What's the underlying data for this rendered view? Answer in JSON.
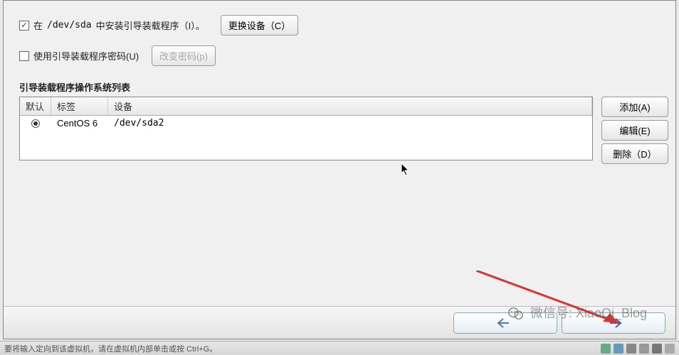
{
  "bootloader": {
    "install_label_pre": "在",
    "install_device": "/dev/sda",
    "install_label_post": "中安装引导装载程序（I）。",
    "install_checked": true,
    "change_device_btn": "更换设备（C）",
    "password_label": "使用引导装载程序密码(U)",
    "password_checked": false,
    "change_password_btn": "改变密码(p)"
  },
  "oslist": {
    "title": "引导装载程序操作系统列表",
    "headers": {
      "default": "默认",
      "label": "标签",
      "device": "设备"
    },
    "rows": [
      {
        "selected": true,
        "label": "CentOS 6",
        "device": "/dev/sda2"
      }
    ]
  },
  "side_buttons": {
    "add": "添加(A)",
    "edit": "编辑(E)",
    "delete": "删除（D）"
  },
  "nav": {
    "back": "返回",
    "next": "下一步"
  },
  "watermark": "微信号: XiaoQi_Blog",
  "status_hint": "要将输入定向到该虚拟机，请在虚拟机内部单击或按 Ctrl+G。"
}
